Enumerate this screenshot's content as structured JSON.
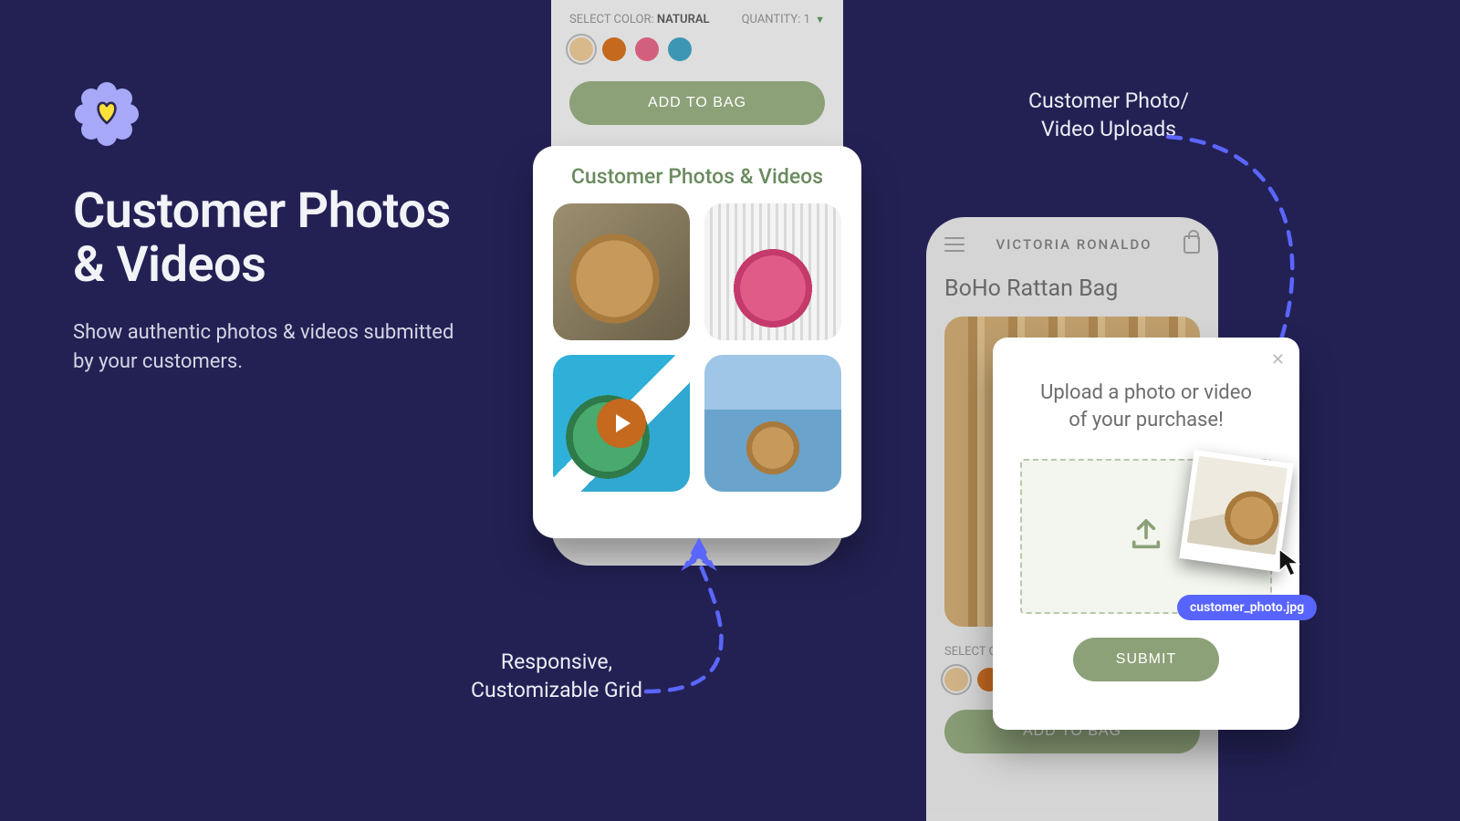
{
  "hero": {
    "title_line1": "Customer Photos",
    "title_line2": "& Videos",
    "subtitle": "Show authentic photos & videos submitted by your customers."
  },
  "annotations": {
    "uploads_line1": "Customer Photo/",
    "uploads_line2": "Video Uploads",
    "grid_line1": "Responsive,",
    "grid_line2": "Customizable Grid"
  },
  "phone_top": {
    "select_color_label": "SELECT COLOR:",
    "selected_color": "NATURAL",
    "quantity_label": "QUANTITY:",
    "quantity_value": "1",
    "swatch_colors": [
      "#d8b98c",
      "#c4691e",
      "#d2607d",
      "#3c96b4"
    ],
    "add_to_bag": "ADD TO BAG"
  },
  "gallery": {
    "title": "Customer Photos & Videos"
  },
  "phone_right": {
    "brand": "VICTORIA RONALDO",
    "product_title": "BoHo Rattan Bag",
    "select_color_label": "SELECT C",
    "swatch_colors": [
      "#d8b98c",
      "#c4691e"
    ],
    "add_to_bag": "ADD TO BAG"
  },
  "upload_modal": {
    "title_line1": "Upload a photo or video",
    "title_line2": "of your purchase!",
    "submit": "SUBMIT"
  },
  "drag": {
    "filename": "customer_photo.jpg"
  }
}
